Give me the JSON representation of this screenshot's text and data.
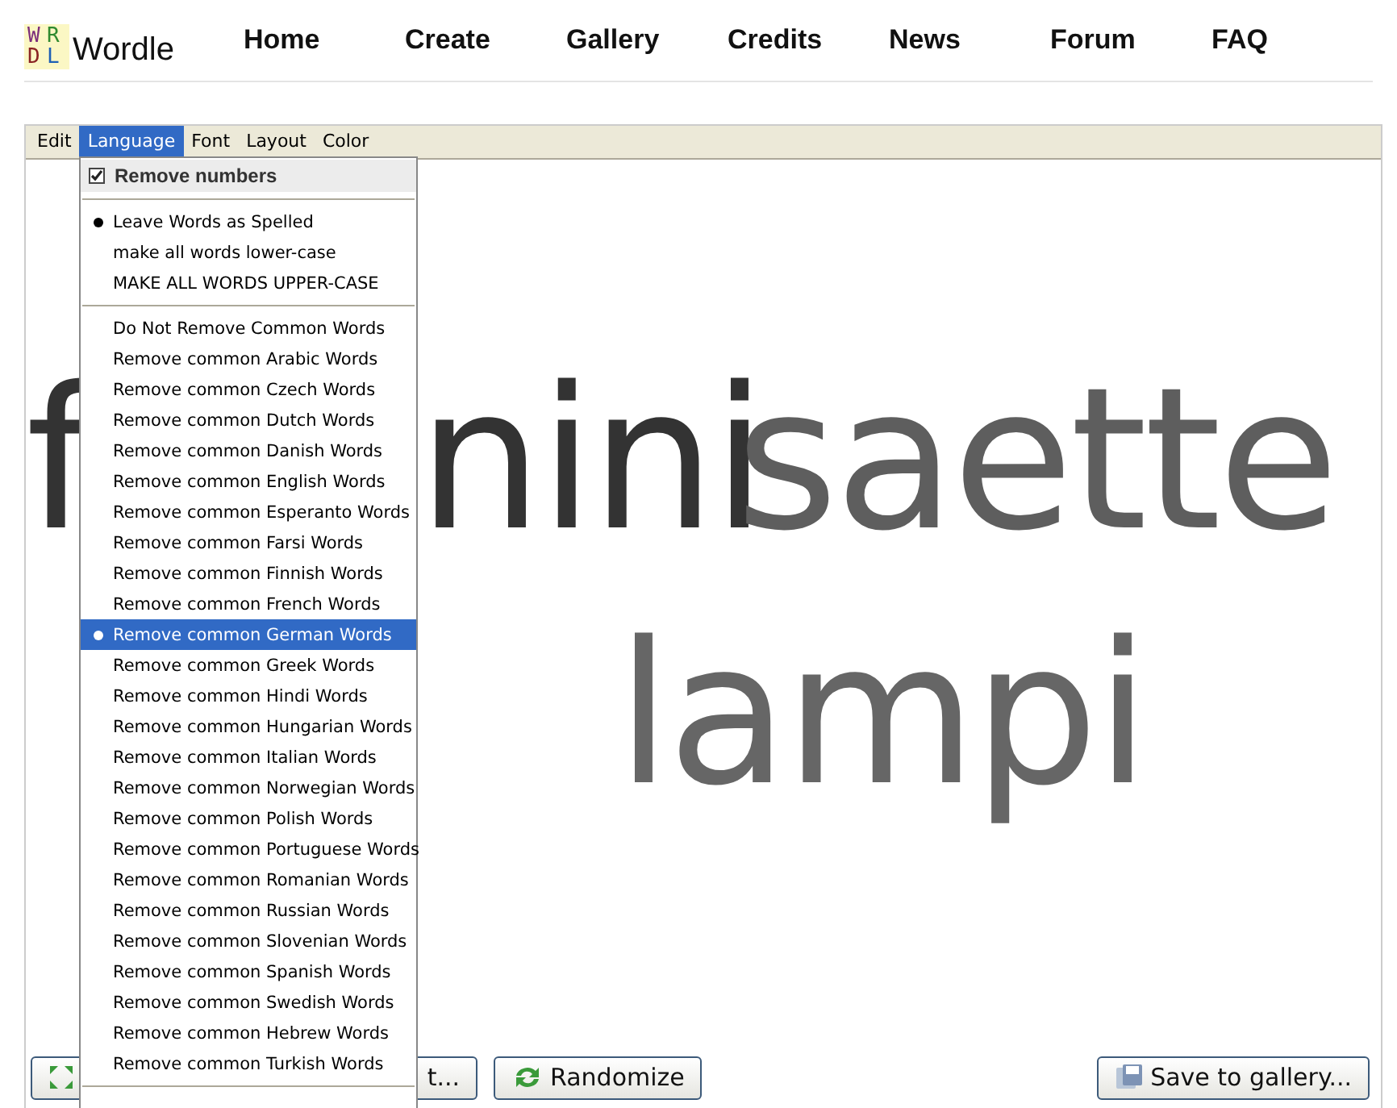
{
  "logo": {
    "letters": [
      "W",
      "R",
      "D",
      "L"
    ],
    "name": "Wordle"
  },
  "nav": [
    "Home",
    "Create",
    "Gallery",
    "Credits",
    "News",
    "Forum",
    "FAQ"
  ],
  "menu_bar": [
    {
      "label": "Edit",
      "selected": false
    },
    {
      "label": "Language",
      "selected": true
    },
    {
      "label": "Font",
      "selected": false
    },
    {
      "label": "Layout",
      "selected": false
    },
    {
      "label": "Color",
      "selected": false
    }
  ],
  "language_menu": {
    "remove_numbers": {
      "label": "Remove numbers",
      "checked": true
    },
    "case_options": [
      {
        "label": "Leave Words as Spelled",
        "selected": true
      },
      {
        "label": "make all words lower-case",
        "selected": false
      },
      {
        "label": "MAKE ALL WORDS UPPER-CASE",
        "selected": false
      }
    ],
    "common_words": [
      {
        "label": "Do Not Remove Common Words",
        "selected": false
      },
      {
        "label": "Remove common Arabic Words",
        "selected": false
      },
      {
        "label": "Remove common Czech Words",
        "selected": false
      },
      {
        "label": "Remove common Dutch Words",
        "selected": false
      },
      {
        "label": "Remove common Danish Words",
        "selected": false
      },
      {
        "label": "Remove common English Words",
        "selected": false
      },
      {
        "label": "Remove common Esperanto Words",
        "selected": false
      },
      {
        "label": "Remove common Farsi Words",
        "selected": false
      },
      {
        "label": "Remove common Finnish Words",
        "selected": false
      },
      {
        "label": "Remove common French Words",
        "selected": false
      },
      {
        "label": "Remove common German Words",
        "selected": true
      },
      {
        "label": "Remove common Greek Words",
        "selected": false
      },
      {
        "label": "Remove common Hindi Words",
        "selected": false
      },
      {
        "label": "Remove common Hungarian Words",
        "selected": false
      },
      {
        "label": "Remove common Italian Words",
        "selected": false
      },
      {
        "label": "Remove common Norwegian Words",
        "selected": false
      },
      {
        "label": "Remove common Polish Words",
        "selected": false
      },
      {
        "label": "Remove common Portuguese Words",
        "selected": false
      },
      {
        "label": "Remove common Romanian Words",
        "selected": false
      },
      {
        "label": "Remove common Russian Words",
        "selected": false
      },
      {
        "label": "Remove common Slovenian Words",
        "selected": false
      },
      {
        "label": "Remove common Spanish Words",
        "selected": false
      },
      {
        "label": "Remove common Swedish Words",
        "selected": false
      },
      {
        "label": "Remove common Hebrew Words",
        "selected": false
      },
      {
        "label": "Remove common Turkish Words",
        "selected": false
      }
    ]
  },
  "cloud_words": [
    {
      "text": "f",
      "color": "#333333"
    },
    {
      "text": "nini",
      "color": "#333333"
    },
    {
      "text": "saette",
      "color": "#5e5e5e"
    },
    {
      "text": "lampi",
      "color": "#666666"
    }
  ],
  "buttons": [
    {
      "kind": "covered",
      "label": "t..."
    },
    {
      "kind": "randomize",
      "label": "Randomize"
    },
    {
      "kind": "save",
      "label": "Save to gallery..."
    }
  ]
}
